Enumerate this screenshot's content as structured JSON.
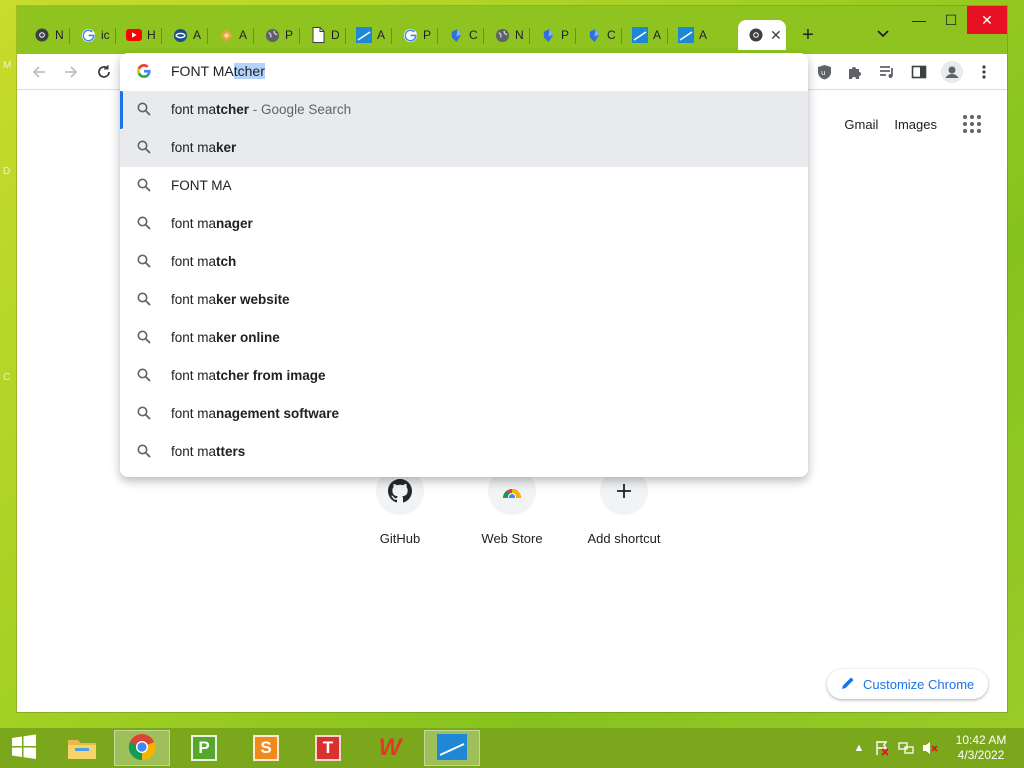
{
  "desktop": {
    "edge_letters": [
      "M",
      "D",
      "C"
    ]
  },
  "browser": {
    "tabs": [
      {
        "short": "N",
        "icon": "chrome-icon"
      },
      {
        "short": "ic",
        "icon": "google-icon"
      },
      {
        "short": "H",
        "icon": "youtube-icon"
      },
      {
        "short": "A",
        "icon": "globe-swirl-icon"
      },
      {
        "short": "A",
        "icon": "diamond-icon"
      },
      {
        "short": "P",
        "icon": "globe-icon"
      },
      {
        "short": "D",
        "icon": "document-icon"
      },
      {
        "short": "A",
        "icon": "app-tile-icon"
      },
      {
        "short": "P",
        "icon": "google-icon"
      },
      {
        "short": "C",
        "icon": "blue-gem-icon"
      },
      {
        "short": "N",
        "icon": "globe-icon"
      },
      {
        "short": "P",
        "icon": "blue-gem-icon"
      },
      {
        "short": "C",
        "icon": "blue-gem-icon"
      },
      {
        "short": "A",
        "icon": "app-tile-icon"
      },
      {
        "short": "A",
        "icon": "app-tile-icon"
      },
      {
        "short": "",
        "icon": "chrome-icon",
        "active": true
      }
    ],
    "window_controls": {
      "minimize": "—",
      "maximize": "☐",
      "close": "✕"
    },
    "omnibox": {
      "typed": "FONT MA",
      "autocomplete": "tcher",
      "suggestions": [
        {
          "plain": "font ma",
          "bold": "tcher",
          "desc": " - Google Search"
        },
        {
          "plain": "font ma",
          "bold": "ker",
          "desc": ""
        },
        {
          "plain": "FONT MA",
          "bold": "",
          "desc": ""
        },
        {
          "plain": "font ma",
          "bold": "nager",
          "desc": ""
        },
        {
          "plain": "font ma",
          "bold": "tch",
          "desc": ""
        },
        {
          "plain": "font ma",
          "bold": "ker website",
          "desc": ""
        },
        {
          "plain": "font ma",
          "bold": "ker online",
          "desc": ""
        },
        {
          "plain": "font ma",
          "bold": "tcher from image",
          "desc": ""
        },
        {
          "plain": "font ma",
          "bold": "nagement software",
          "desc": ""
        },
        {
          "plain": "font ma",
          "bold": "tters",
          "desc": ""
        }
      ]
    }
  },
  "page": {
    "top_links": {
      "gmail": "Gmail",
      "images": "Images"
    },
    "shortcuts": [
      {
        "label": "GitHub",
        "icon": "github-icon"
      },
      {
        "label": "Web Store",
        "icon": "web-store-icon"
      },
      {
        "label": "Add shortcut",
        "icon": "plus-icon"
      }
    ],
    "customize": "Customize Chrome"
  },
  "taskbar": {
    "apps": [
      {
        "name": "file-explorer",
        "letter": ""
      },
      {
        "name": "chrome",
        "letter": ""
      },
      {
        "name": "wps-presentation",
        "letter": "P",
        "color": "#56a82c"
      },
      {
        "name": "wps-spreadsheets",
        "letter": "S",
        "color": "#f08a1c"
      },
      {
        "name": "wps-writer",
        "letter": "T",
        "color": "#d9312b"
      },
      {
        "name": "wps-office",
        "letter": "W",
        "color": "#e8352b"
      },
      {
        "name": "app-tile",
        "letter": ""
      }
    ],
    "clock": {
      "time": "10:42 AM",
      "date": "4/3/2022"
    },
    "tray_arrow": "▲"
  },
  "colors": {
    "accent": "#1a73e8",
    "titlebar": "#8fc31f",
    "taskbar": "#7aa71c",
    "close": "#e81123"
  }
}
